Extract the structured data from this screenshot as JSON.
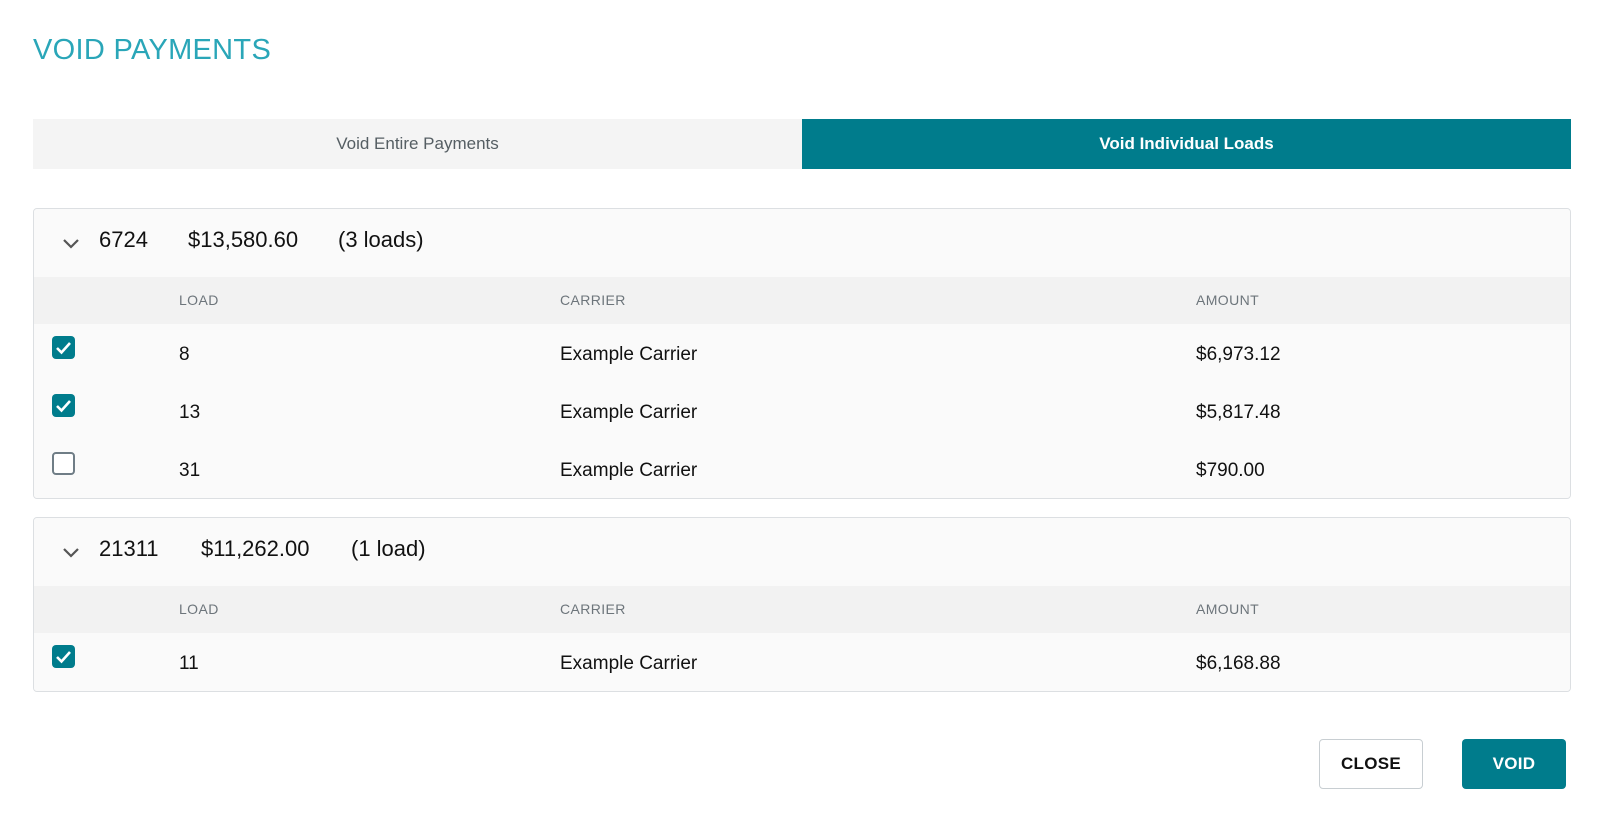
{
  "dialog": {
    "title": "VOID PAYMENTS"
  },
  "tabs": [
    {
      "label": "Void Entire Payments",
      "active": false
    },
    {
      "label": "Void Individual Loads",
      "active": true
    }
  ],
  "columns": {
    "load": "LOAD",
    "carrier": "CARRIER",
    "amount": "AMOUNT"
  },
  "groups": [
    {
      "id": "6724",
      "total": "$13,580.60",
      "count_label": "(3 loads)",
      "rows": [
        {
          "load": "8",
          "carrier": "Example Carrier",
          "amount": "$6,973.12",
          "checked": true
        },
        {
          "load": "13",
          "carrier": "Example Carrier",
          "amount": "$5,817.48",
          "checked": true
        },
        {
          "load": "31",
          "carrier": "Example Carrier",
          "amount": "$790.00",
          "checked": false
        }
      ]
    },
    {
      "id": "21311",
      "total": "$11,262.00",
      "count_label": "(1 load)",
      "rows": [
        {
          "load": "11",
          "carrier": "Example Carrier",
          "amount": "$6,168.88",
          "checked": true
        }
      ]
    }
  ],
  "actions": {
    "close_label": "CLOSE",
    "void_label": "VOID"
  },
  "icons": {
    "expand": "chevron-down-icon",
    "check": "check-icon"
  },
  "colors": {
    "accent": "#007c8c",
    "title": "#2aa6b8"
  }
}
